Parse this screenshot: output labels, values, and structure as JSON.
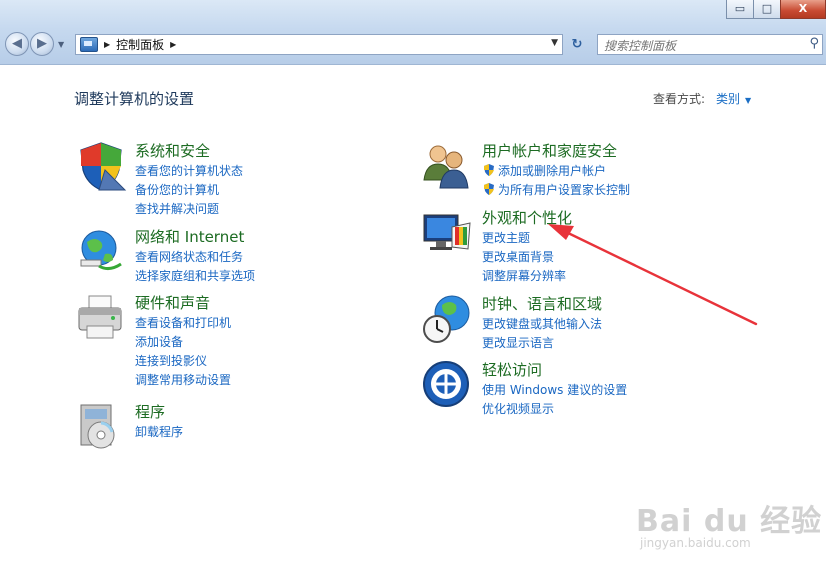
{
  "window": {
    "controls": {
      "minimize": "▭",
      "maximize": "□",
      "close": "X"
    }
  },
  "toolbar": {
    "breadcrumb": "控制面板",
    "search_placeholder": "搜索控制面板"
  },
  "header": {
    "title": "调整计算机的设置",
    "view_by_label": "查看方式:",
    "view_by_value": "类别"
  },
  "categories": {
    "left": [
      {
        "title": "系统和安全",
        "icon": "shield-icon",
        "links": [
          "查看您的计算机状态",
          "备份您的计算机",
          "查找并解决问题"
        ]
      },
      {
        "title": "网络和 Internet",
        "icon": "network-globe-icon",
        "links": [
          "查看网络状态和任务",
          "选择家庭组和共享选项"
        ]
      },
      {
        "title": "硬件和声音",
        "icon": "printer-icon",
        "links": [
          "查看设备和打印机",
          "添加设备",
          "连接到投影仪",
          "调整常用移动设置"
        ]
      },
      {
        "title": "程序",
        "icon": "programs-disc-icon",
        "links": [
          "卸载程序"
        ]
      }
    ],
    "right": [
      {
        "title": "用户帐户和家庭安全",
        "icon": "users-icon",
        "links": [
          "添加或删除用户帐户",
          "为所有用户设置家长控制"
        ]
      },
      {
        "title": "外观和个性化",
        "icon": "monitor-palette-icon",
        "links": [
          "更改主题",
          "更改桌面背景",
          "调整屏幕分辨率"
        ]
      },
      {
        "title": "时钟、语言和区域",
        "icon": "clock-globe-icon",
        "links": [
          "更改键盘或其他输入法",
          "更改显示语言"
        ]
      },
      {
        "title": "轻松访问",
        "icon": "ease-of-access-icon",
        "links": [
          "使用 Windows 建议的设置",
          "优化视频显示"
        ]
      }
    ]
  },
  "annotation": {
    "arrow_color": "#e8333a"
  },
  "watermark": {
    "logo": "Bai du 经验",
    "url": "jingyan.baidu.com"
  }
}
